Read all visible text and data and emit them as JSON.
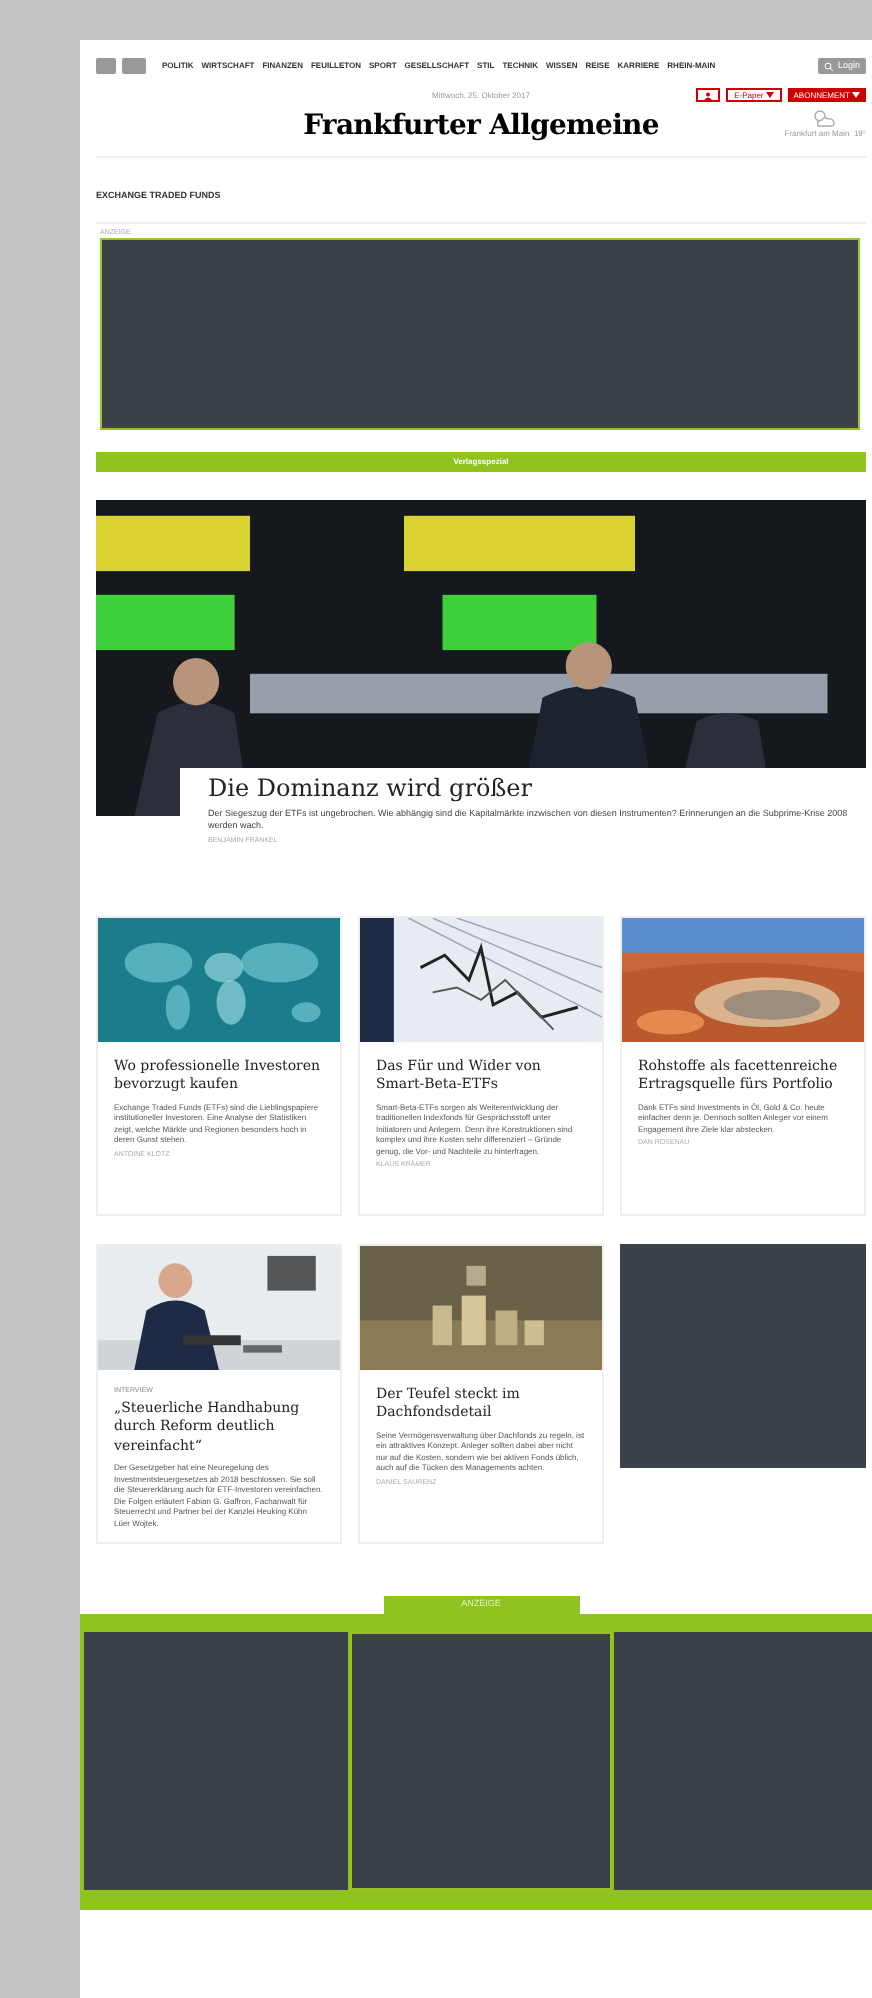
{
  "nav": {
    "items": [
      "POLITIK",
      "WIRTSCHAFT",
      "FINANZEN",
      "FEUILLETON",
      "SPORT",
      "GESELLSCHAFT",
      "STIL",
      "TECHNIK",
      "WISSEN",
      "REISE",
      "KARRIERE",
      "RHEIN-MAIN"
    ],
    "login": "Login"
  },
  "header": {
    "date": "Mittwoch, 25. Oktober 2017",
    "epaper": "E-Paper",
    "subscribe": "ABONNEMENT",
    "logo": "Frankfurter Allgemeine",
    "weather": "Frankfurt am Main  19°"
  },
  "section": "EXCHANGE TRADED FUNDS",
  "top_ad": {
    "label": "ANZEIGE"
  },
  "banner": "Verlagsspezial",
  "hero": {
    "title": "Die Dominanz wird größer",
    "teaser": "Der Siegeszug der ETFs ist ungebrochen. Wie abhängig sind die Kapitalmärkte inzwischen von diesen Instrumenten? Erinnerungen an die Subprime-Krise 2008 werden wach.",
    "author": "BENJAMIN FRÄNKEL"
  },
  "cards": [
    {
      "kind": "article",
      "title": "Wo professionelle Investoren bevorzugt kaufen",
      "teaser": "Exchange Traded Funds (ETFs) sind die Lieblingspapiere institutioneller Investoren. Eine Analyse der Statistiken zeigt, welche Märkte und Regionen besonders hoch in deren Gunst stehen.",
      "author": "ANTOINE KLOTZ"
    },
    {
      "kind": "article",
      "title": "Das Für und Wider von Smart-Beta-ETFs",
      "teaser": "Smart-Beta-ETFs sorgen als Weiterentwicklung der traditionellen Indexfonds für Gesprächsstoff unter Initiatoren und Anlegern. Denn ihre Konstruktionen sind komplex und ihre Kosten sehr differenziert – Gründe genug, die Vor- und Nachteile zu hinterfragen.",
      "author": "KLAUS KRÄMER"
    },
    {
      "kind": "article",
      "title": "Rohstoffe als facettenreiche Ertragsquelle fürs Portfolio",
      "teaser": "Dank ETFs sind Investments in Öl, Gold & Co. heute einfacher denn je. Dennoch sollten Anleger vor einem Engagement ihre Ziele klar abstecken.",
      "author": "DAN ROSENAU"
    },
    {
      "kind": "article",
      "kicker": "INTERVIEW",
      "title": "„Steuerliche Handhabung durch Reform deutlich vereinfacht“",
      "teaser": "Der Gesetzgeber hat eine Neuregelung des Investmentsteuergesetzes ab 2018 beschlossen. Sie soll die Steuererklärung auch für ETF-Investoren vereinfachen. Die Folgen erläutert Fabian G. Gaffron, Fachanwalt für Steuerrecht und Partner bei der Kanzlei Heuking Kühn Lüer Wojtek."
    },
    {
      "kind": "article",
      "title": "Der Teufel steckt im Dachfondsdetail",
      "teaser": "Seine Vermögensverwaltung über Dachfonds zu regeln, ist ein attraktives Konzept. Anleger sollten dabei aber nicht nur auf die Kosten, sondern wie bei aktiven Fonds üblich, auch auf die Tücken des Managements achten.",
      "author": "DANIEL SAURENZ"
    },
    {
      "kind": "ad"
    }
  ],
  "bottom_ad": {
    "label": "ANZEIGE"
  }
}
